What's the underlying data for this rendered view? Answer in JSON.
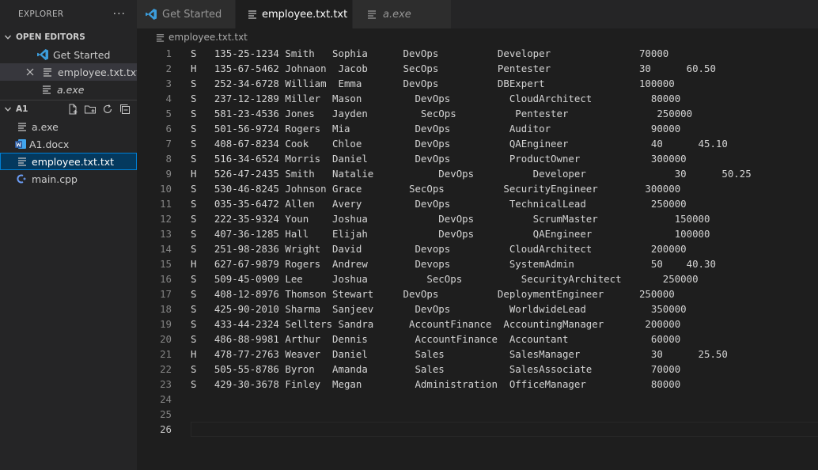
{
  "sidebar": {
    "title": "EXPLORER",
    "more_label": "···",
    "open_editors": {
      "label": "OPEN EDITORS",
      "items": [
        {
          "name": "Get Started",
          "italic": false
        },
        {
          "name": "employee.txt.txt",
          "italic": false
        },
        {
          "name": "a.exe",
          "italic": true
        }
      ]
    },
    "folder": {
      "label": "A1",
      "files": [
        {
          "name": "a.exe"
        },
        {
          "name": "A1.docx"
        },
        {
          "name": "employee.txt.txt"
        },
        {
          "name": "main.cpp"
        }
      ]
    }
  },
  "tabs": [
    {
      "label": "Get Started",
      "active": false
    },
    {
      "label": "employee.txt.txt",
      "active": true
    },
    {
      "label": "a.exe",
      "active": false
    }
  ],
  "breadcrumb": {
    "file": "employee.txt.txt"
  },
  "editor": {
    "active_line": 26,
    "lines": [
      "S   135-25-1234 Smith   Sophia      DevOps          Developer               70000",
      "H   135-67-5462 Johnaon  Jacob      SecOps          Pentester               30      60.50",
      "S   252-34-6728 William  Emma       DevOps          DBExpert                100000",
      "S   237-12-1289 Miller  Mason         DevOps          CloudArchitect          80000",
      "S   581-23-4536 Jones   Jayden         SecOps          Pentester               250000",
      "S   501-56-9724 Rogers  Mia           DevOps          Auditor                 90000",
      "S   408-67-8234 Cook    Chloe         DevOps          QAEngineer              40      45.10",
      "S   516-34-6524 Morris  Daniel        DevOps          ProductOwner            300000",
      "H   526-47-2435 Smith   Natalie           DevOps          Developer               30      50.25",
      "S   530-46-8245 Johnson Grace        SecOps          SecurityEngineer        300000",
      "S   035-35-6472 Allen   Avery         DevOps          TechnicalLead           250000",
      "S   222-35-9324 Youn    Joshua            DevOps          ScrumMaster             150000",
      "S   407-36-1285 Hall    Elijah            DevOps          QAEngineer              100000",
      "S   251-98-2836 Wright  David         Devops          CloudArchitect          200000",
      "H   627-67-9879 Rogers  Andrew        Devops          SystemAdmin             50    40.30",
      "S   509-45-0909 Lee     Joshua          SecOps          SecurityArchitect       250000",
      "S   408-12-8976 Thomson Stewart     DevOps          DeploymentEngineer      250000",
      "S   425-90-2010 Sharma  Sanjeev       DevOps          WorldwideLead           350000",
      "S   433-44-2324 Sellters Sandra      AccountFinance  AccountingManager       200000",
      "S   486-88-9981 Arthur  Dennis        AccountFinance  Accountant              60000",
      "H   478-77-2763 Weaver  Daniel        Sales           SalesManager            30      25.50",
      "S   505-55-8786 Byron   Amanda        Sales           SalesAssociate          70000",
      "S   429-30-3678 Finley  Megan         Administration  OfficeManager           80000",
      "",
      "",
      ""
    ]
  },
  "colors": {
    "vscode_blue": "#3c9ddc",
    "word_blue": "#2b579a",
    "cpp_blue": "#6c9ef8",
    "selection_border": "#007fd4"
  }
}
